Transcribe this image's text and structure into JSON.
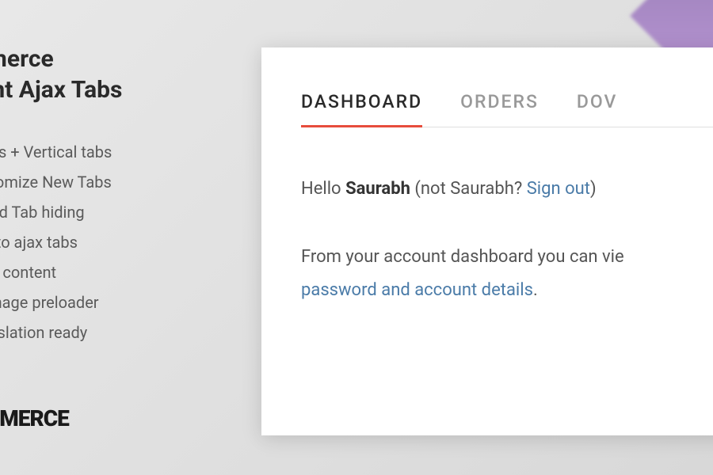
{
  "sidebar": {
    "title_line1": "ommerce",
    "title_line2": "count Ajax Tabs",
    "features": [
      "b styles + Vertical tabs",
      " / Customize New Tabs",
      "e based Tab hiding",
      "vert into ajax tabs",
      "es Tab content",
      "tom image preloader",
      " & Translation ready"
    ],
    "brand": "COMMERCE"
  },
  "panel": {
    "tabs": [
      {
        "label": "DASHBOARD",
        "active": true
      },
      {
        "label": "ORDERS",
        "active": false
      },
      {
        "label": "DOV",
        "active": false
      }
    ],
    "greeting": {
      "prefix": "Hello ",
      "username": "Saurabh",
      "not_prefix": " (not Saurabh? ",
      "signout": "Sign out",
      "suffix": ")"
    },
    "body": {
      "line1": "From your account dashboard you can vie",
      "link": "password and account details",
      "period": "."
    }
  }
}
